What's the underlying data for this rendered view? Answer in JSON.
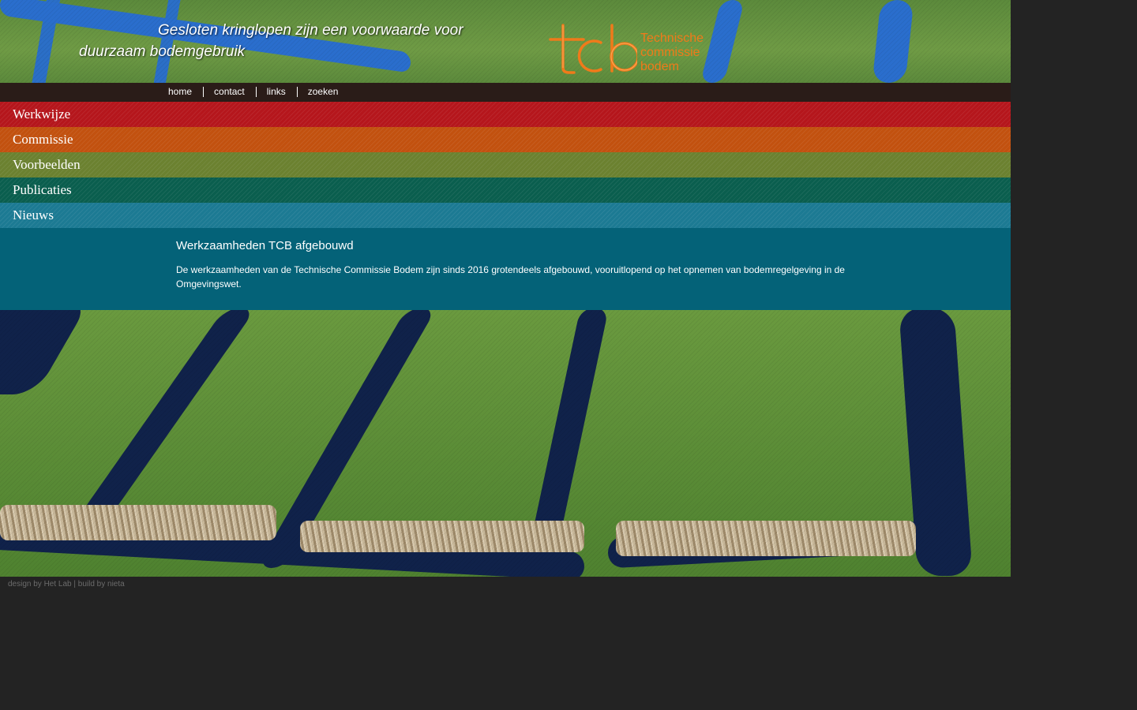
{
  "header": {
    "tagline": "Gesloten kringlopen zijn een voorwaarde voor duurzaam bodemgebruik",
    "logo": {
      "mark": "tcb",
      "line1": "Technische",
      "line2": "commissie",
      "line3": "bodem",
      "color": "#f07a1a"
    }
  },
  "topnav": {
    "items": [
      "home",
      "contact",
      "links",
      "zoeken"
    ]
  },
  "menu": {
    "items": [
      {
        "label": "Werkwijze",
        "color": "#b5161c"
      },
      {
        "label": "Commissie",
        "color": "#c2510f"
      },
      {
        "label": "Voorbeelden",
        "color": "#6b8130"
      },
      {
        "label": "Publicaties",
        "color": "#0a5e4e"
      },
      {
        "label": "Nieuws",
        "color": "#1c7a93"
      }
    ]
  },
  "content": {
    "title": "Werkzaamheden TCB afgebouwd",
    "body": "De werkzaamheden van de Technische Commissie Bodem zijn sinds 2016 grotendeels afgebouwd, vooruitlopend op het opnemen van bodemregelgeving in de Omgevingswet.",
    "background": "#046278"
  },
  "footer": {
    "text": "design by Het Lab | build by nieta"
  }
}
